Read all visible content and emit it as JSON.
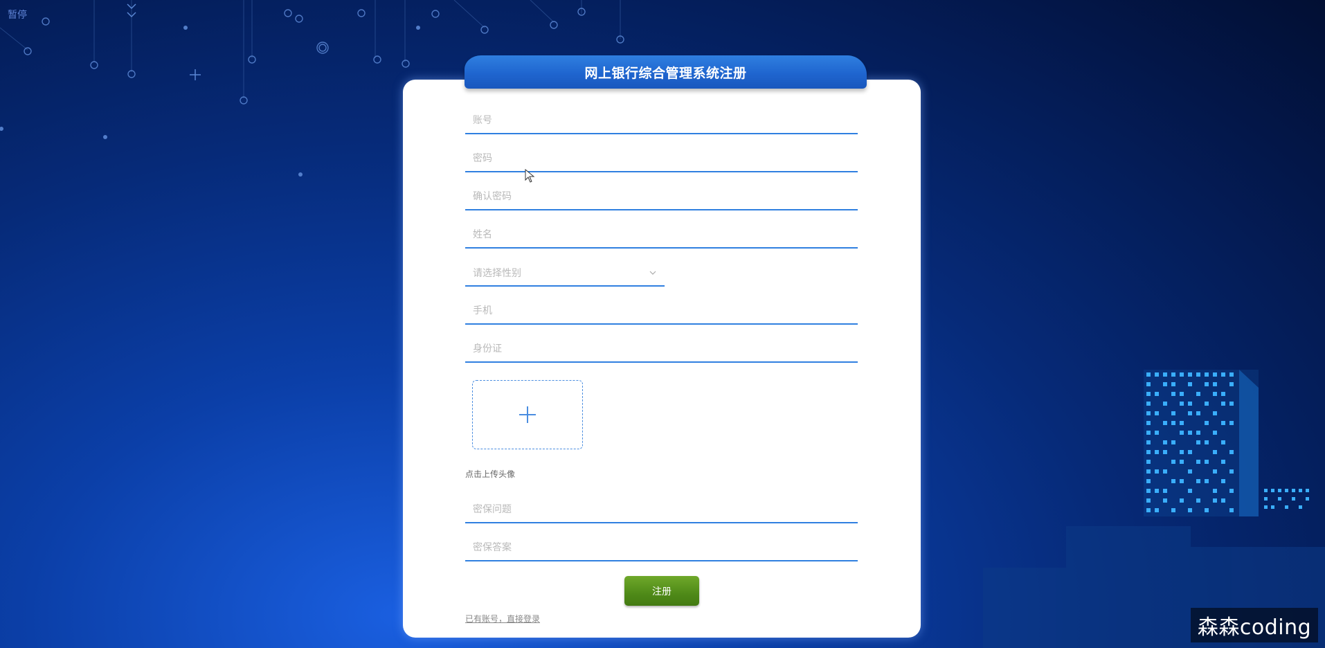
{
  "page": {
    "pause_label": "暂停",
    "title": "网上银行综合管理系统注册",
    "watermark": "森森coding"
  },
  "form": {
    "account_placeholder": "账号",
    "password_placeholder": "密码",
    "confirm_password_placeholder": "确认密码",
    "name_placeholder": "姓名",
    "gender_select": {
      "placeholder": "请选择性别",
      "options_visible": []
    },
    "phone_placeholder": "手机",
    "idcard_placeholder": "身份证",
    "upload_caption": "点击上传头像",
    "security_question_placeholder": "密保问题",
    "security_answer_placeholder": "密保答案",
    "submit_label": "注册",
    "login_link": "已有账号，直接登录"
  },
  "icons": {
    "upload": "plus-icon",
    "select_arrow": "chevron-down-icon",
    "cursor": "mouse-pointer-icon"
  },
  "colors": {
    "accent": "#2f7fe0",
    "submit": "#5a9620",
    "background_dark": "#03174a"
  }
}
